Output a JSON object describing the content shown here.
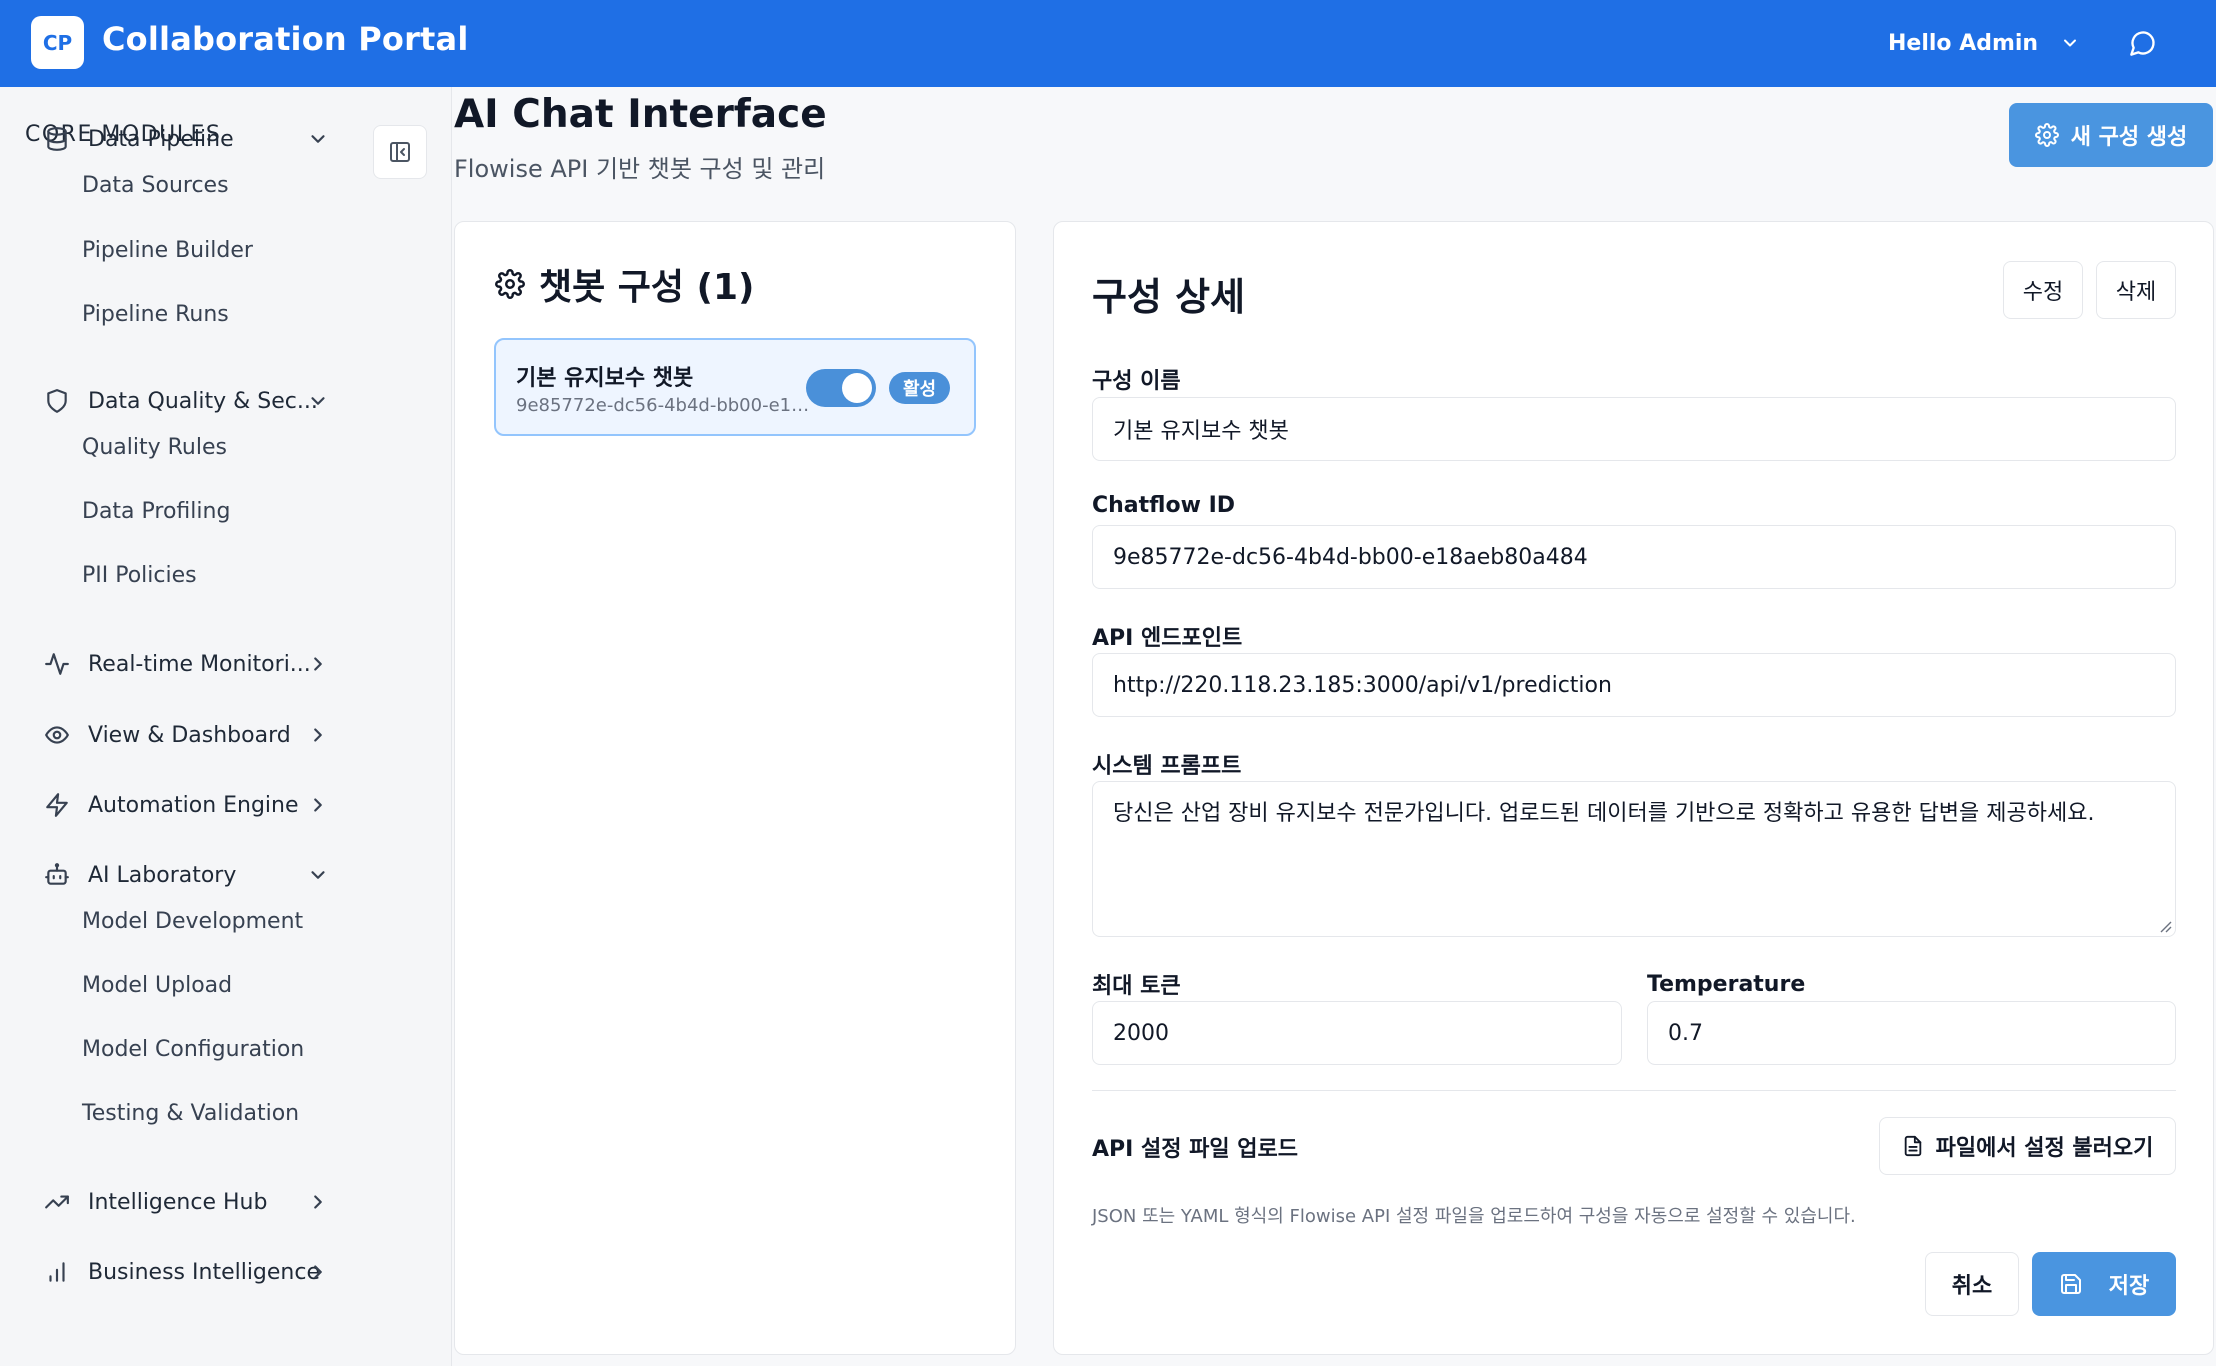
{
  "topbar": {
    "logo_text": "CP",
    "title": "Collaboration Portal",
    "user_greeting": "Hello Admin",
    "accent_color": "#1f6fe5"
  },
  "sidebar": {
    "section_title": "CORE MODULES",
    "items": [
      {
        "label": "Data Pipeline",
        "icon": "database-icon",
        "expanded": true,
        "children": [
          "Data Sources",
          "Pipeline Builder",
          "Pipeline Runs"
        ]
      },
      {
        "label": "Data Quality & Sec...",
        "icon": "shield-icon",
        "expanded": true,
        "children": [
          "Quality Rules",
          "Data Profiling",
          "PII Policies"
        ]
      },
      {
        "label": "Real-time Monitori...",
        "icon": "activity-icon",
        "expanded": false
      },
      {
        "label": "View & Dashboard",
        "icon": "eye-icon",
        "expanded": false
      },
      {
        "label": "Automation Engine",
        "icon": "lightning-icon",
        "expanded": false
      },
      {
        "label": "AI Laboratory",
        "icon": "bot-icon",
        "expanded": true,
        "children": [
          "Model Development",
          "Model Upload",
          "Model Configuration",
          "Testing & Validation"
        ]
      },
      {
        "label": "Intelligence Hub",
        "icon": "trending-up-icon",
        "expanded": false
      },
      {
        "label": "Business Intelligence",
        "icon": "bar-chart-icon",
        "expanded": false
      }
    ]
  },
  "page": {
    "title": "AI Chat Interface",
    "subtitle": "Flowise API 기반 챗봇 구성 및 관리",
    "new_config_label": "새 구성 생성"
  },
  "config_list": {
    "title": "챗봇 구성 (1)",
    "items": [
      {
        "name": "기본 유지보수 챗봇",
        "id": "9e85772e-dc56-4b4d-bb00-e18aeb80a484",
        "enabled": true,
        "status": "활성"
      }
    ]
  },
  "detail": {
    "title": "구성 상세",
    "edit_label": "수정",
    "delete_label": "삭제",
    "name_label": "구성 이름",
    "name_value": "기본 유지보수 챗봇",
    "chatflow_label": "Chatflow ID",
    "chatflow_value": "9e85772e-dc56-4b4d-bb00-e18aeb80a484",
    "endpoint_label": "API 엔드포인트",
    "endpoint_value": "http://220.118.23.185:3000/api/v1/prediction",
    "prompt_label": "시스템 프롬프트",
    "prompt_value": "당신은 산업 장비 유지보수 전문가입니다. 업로드된 데이터를 기반으로 정확하고 유용한 답변을 제공하세요.",
    "max_tokens_label": "최대 토큰",
    "max_tokens_value": "2000",
    "temperature_label": "Temperature",
    "temperature_value": "0.7",
    "upload_label": "API 설정 파일 업로드",
    "upload_button": "파일에서 설정 불러오기",
    "upload_hint": "JSON 또는 YAML 형식의 Flowise API 설정 파일을 업로드하여 구성을 자동으로 설정할 수 있습니다.",
    "cancel_label": "취소",
    "save_label": "저장"
  }
}
